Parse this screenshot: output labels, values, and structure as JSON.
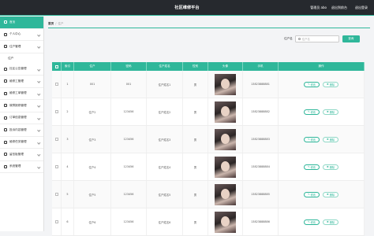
{
  "header": {
    "title": "社区维修平台",
    "admin": "管理员 abo",
    "logout_label": "退出到前台",
    "exit_label": "退出登录"
  },
  "sidebar": {
    "items": [
      {
        "label": "首页",
        "active": true
      },
      {
        "label": "个人中心"
      },
      {
        "label": "住户管理"
      },
      {
        "label": "住户",
        "sub": true
      },
      {
        "label": "社区公告管理"
      },
      {
        "label": "维修工管理"
      },
      {
        "label": "维修工单管理"
      },
      {
        "label": "故障报修管理"
      },
      {
        "label": "订单信息管理"
      },
      {
        "label": "投诉内容管理"
      },
      {
        "label": "维修任务管理"
      },
      {
        "label": "留言板管理"
      },
      {
        "label": "系统管理"
      }
    ]
  },
  "breadcrumb": {
    "home": "首页",
    "sep": "/",
    "current": "住户"
  },
  "search": {
    "label": "住户名",
    "placeholder": "住户名",
    "button": "查询"
  },
  "table": {
    "headers": [
      "索引",
      "住户",
      "密码",
      "住户姓名",
      "性别",
      "头像",
      "手机",
      "操作"
    ],
    "rows": [
      {
        "idx": "1",
        "account": "001",
        "password": "001",
        "name": "住户姓名1",
        "sex": "男",
        "phone": "13823888881"
      },
      {
        "idx": "2",
        "account": "住户2",
        "password": "123456",
        "name": "住户姓名2",
        "sex": "男",
        "phone": "13823888882"
      },
      {
        "idx": "3",
        "account": "住户3",
        "password": "123456",
        "name": "住户姓名3",
        "sex": "男",
        "phone": "13823888883"
      },
      {
        "idx": "4",
        "account": "住户4",
        "password": "123456",
        "name": "住户姓名4",
        "sex": "男",
        "phone": "13823888884"
      },
      {
        "idx": "5",
        "account": "住户5",
        "password": "123456",
        "name": "住户姓名5",
        "sex": "男",
        "phone": "13823888885"
      },
      {
        "idx": "6",
        "account": "住户6",
        "password": "123456",
        "name": "住户姓名6",
        "sex": "男",
        "phone": "13823888886"
      }
    ],
    "edit_label": "修改",
    "delete_label": "删除"
  },
  "colors": {
    "accent": "#2fb79a",
    "topbar": "#26292e"
  }
}
